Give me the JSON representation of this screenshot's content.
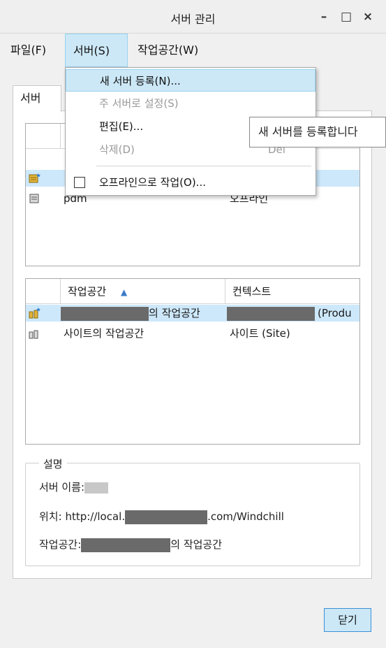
{
  "window": {
    "title": "서버 관리",
    "buttons": {
      "minimize": "–",
      "maximize": "□",
      "close": "×"
    }
  },
  "menubar": [
    {
      "label": "파일(F)"
    },
    {
      "label": "서버(S)",
      "active": true
    },
    {
      "label": "작업공간(W)"
    }
  ],
  "tab": {
    "label": "서버"
  },
  "servers_list": {
    "rows": [
      {
        "name": "",
        "status": "",
        "selected": true,
        "icon": "server-active-icon"
      },
      {
        "name": "pdm",
        "status": "오프라인",
        "selected": false,
        "icon": "server-icon"
      }
    ]
  },
  "workspace_list": {
    "columns": [
      "작업공간",
      "컨텍스트"
    ],
    "sort_indicator": "▲",
    "rows": [
      {
        "workspace_suffix": "의 작업공간",
        "context_suffix": "(Produ",
        "selected": true,
        "icon": "workspace-active-icon"
      },
      {
        "workspace": "사이트의 작업공간",
        "context": "사이트 (Site)",
        "selected": false,
        "icon": "workspace-icon"
      }
    ]
  },
  "description": {
    "legend": "설명",
    "server_name_label": "서버 이름:",
    "location_label": "위치:",
    "location_prefix": "http://local.",
    "location_suffix": ".com/Windchill",
    "workspace_label": "작업공간:",
    "workspace_suffix": "의 작업공간"
  },
  "close_button": "닫기",
  "server_menu": {
    "items": [
      {
        "label": "새 서버 등록(N)...",
        "highlighted": true
      },
      {
        "label": "주 서버로 설정(S)",
        "disabled": true
      },
      {
        "label": "편집(E)..."
      },
      {
        "label": "삭제(D)",
        "disabled": true
      },
      {
        "label": "오프라인으로 작업(O)...",
        "checkbox": true
      }
    ],
    "shortcut_partial": "Del"
  },
  "tooltip": "새 서버를 등록합니다",
  "colors": {
    "selection": "#cde8fb",
    "menu_highlight": "#cce8f7",
    "accent_border": "#3c8fd6"
  }
}
